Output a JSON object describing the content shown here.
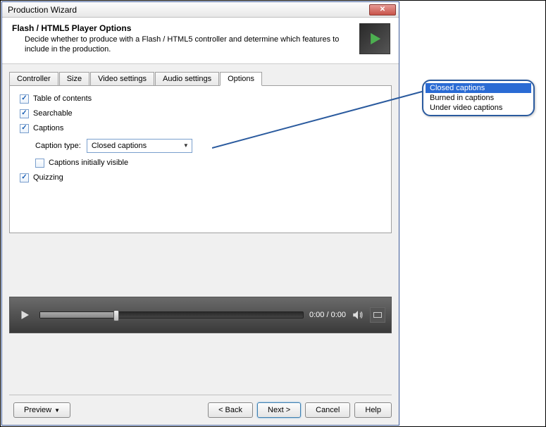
{
  "window": {
    "title": "Production Wizard"
  },
  "header": {
    "title": "Flash / HTML5 Player Options",
    "desc": "Decide whether to produce with a Flash / HTML5 controller and determine which features to include in the production."
  },
  "tabs": {
    "controller": "Controller",
    "size": "Size",
    "video": "Video settings",
    "audio": "Audio settings",
    "options": "Options"
  },
  "options": {
    "toc": "Table of contents",
    "search": "Searchable",
    "captions": "Captions",
    "caption_type_label": "Caption type:",
    "caption_type_value": "Closed captions",
    "captions_visible": "Captions initially visible",
    "quizzing": "Quizzing"
  },
  "player": {
    "time": "0:00  /  0:00"
  },
  "buttons": {
    "preview": "Preview",
    "back": "< Back",
    "next": "Next >",
    "cancel": "Cancel",
    "help": "Help"
  },
  "dropdown_options": {
    "o1": "Closed captions",
    "o2": "Burned in captions",
    "o3": "Under video captions"
  }
}
